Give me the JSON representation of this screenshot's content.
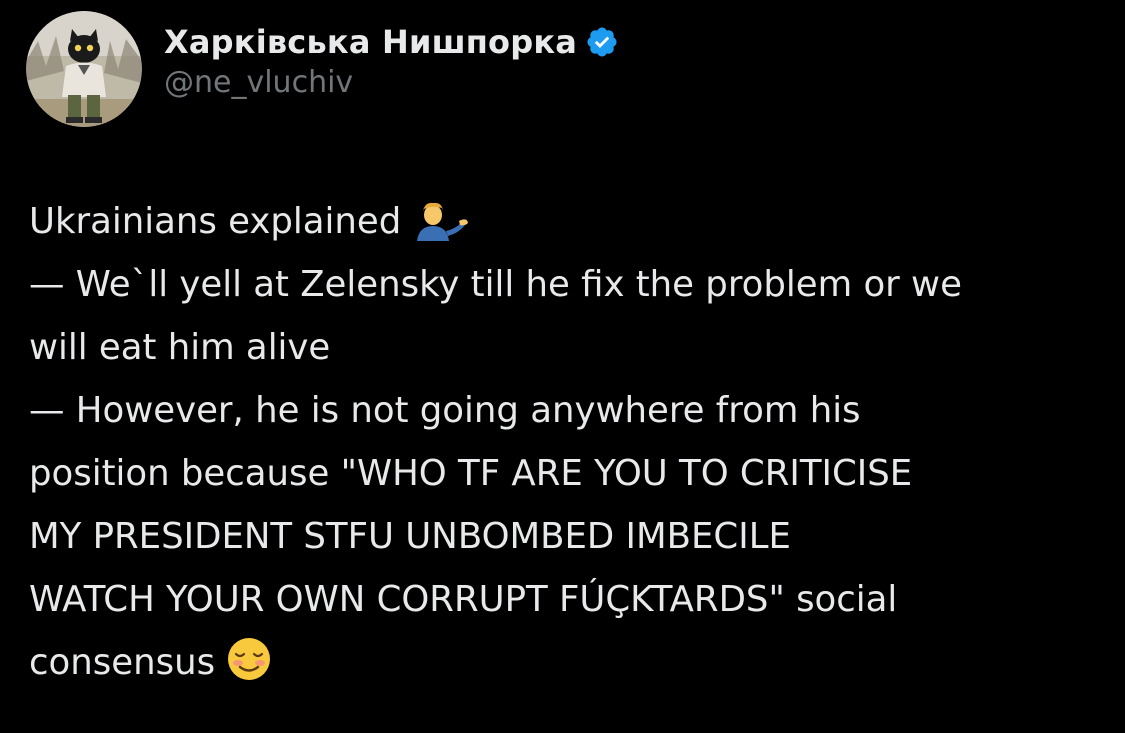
{
  "tweet": {
    "author": {
      "display_name": "Харківська Нишпорка",
      "handle": "@ne_vluchiv",
      "verified": true,
      "verified_color": "#1d9bf0",
      "avatar_icon": "cat-avatar-icon"
    },
    "body_lines": [
      "Ukrainians explained",
      "— We`ll yell at Zelensky till he fix the problem or we",
      "will eat him alive",
      "— However, he is not going anywhere from his",
      "position because \"WHO TF ARE YOU TO CRITICISE",
      "MY PRESIDENT STFU UNBOMBED IMBECILE",
      "WATCH YOUR OWN CORRUPT FÚÇKTARDS\" social",
      "consensus"
    ],
    "emojis": {
      "line_1": "man-tipping-hand-emoji",
      "line_8": "smiling-face-emoji"
    }
  },
  "colors": {
    "background": "#000000",
    "text_primary": "#e7e9ea",
    "text_secondary": "#71767b"
  }
}
